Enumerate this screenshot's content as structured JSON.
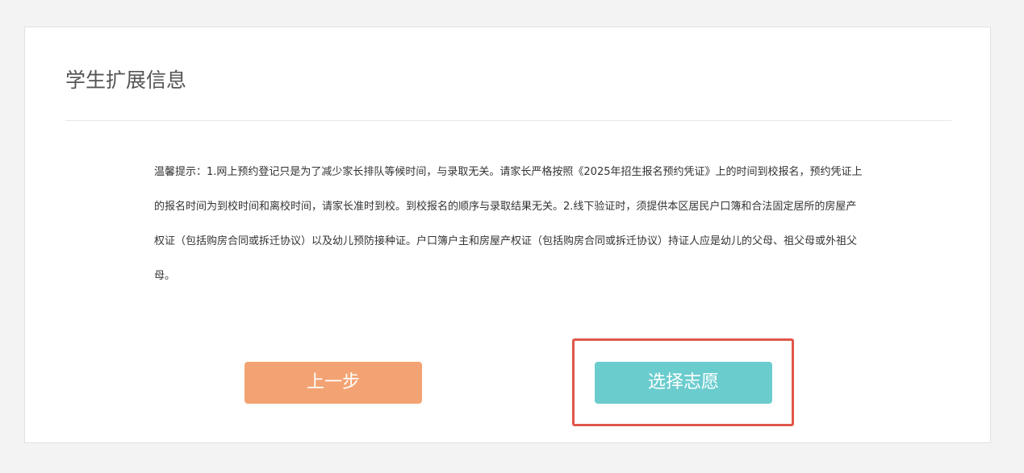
{
  "card": {
    "title": "学生扩展信息"
  },
  "notice": {
    "text": "温馨提示：1.网上预约登记只是为了减少家长排队等候时间，与录取无关。请家长严格按照《2025年招生报名预约凭证》上的时间到校报名，预约凭证上的报名时间为到校时间和离校时间，请家长准时到校。到校报名的顺序与录取结果无关。2.线下验证时，须提供本区居民户口簿和合法固定居所的房屋产权证（包括购房合同或拆迁协议）以及幼儿预防接种证。户口簿户主和房屋产权证（包括购房合同或拆迁协议）持证人应是幼儿的父母、祖父母或外祖父母。"
  },
  "actions": {
    "prev_label": "上一步",
    "next_label": "选择志愿"
  },
  "colors": {
    "prev_button": "#f3a373",
    "next_button": "#6bccce",
    "highlight": "#e0574a"
  }
}
